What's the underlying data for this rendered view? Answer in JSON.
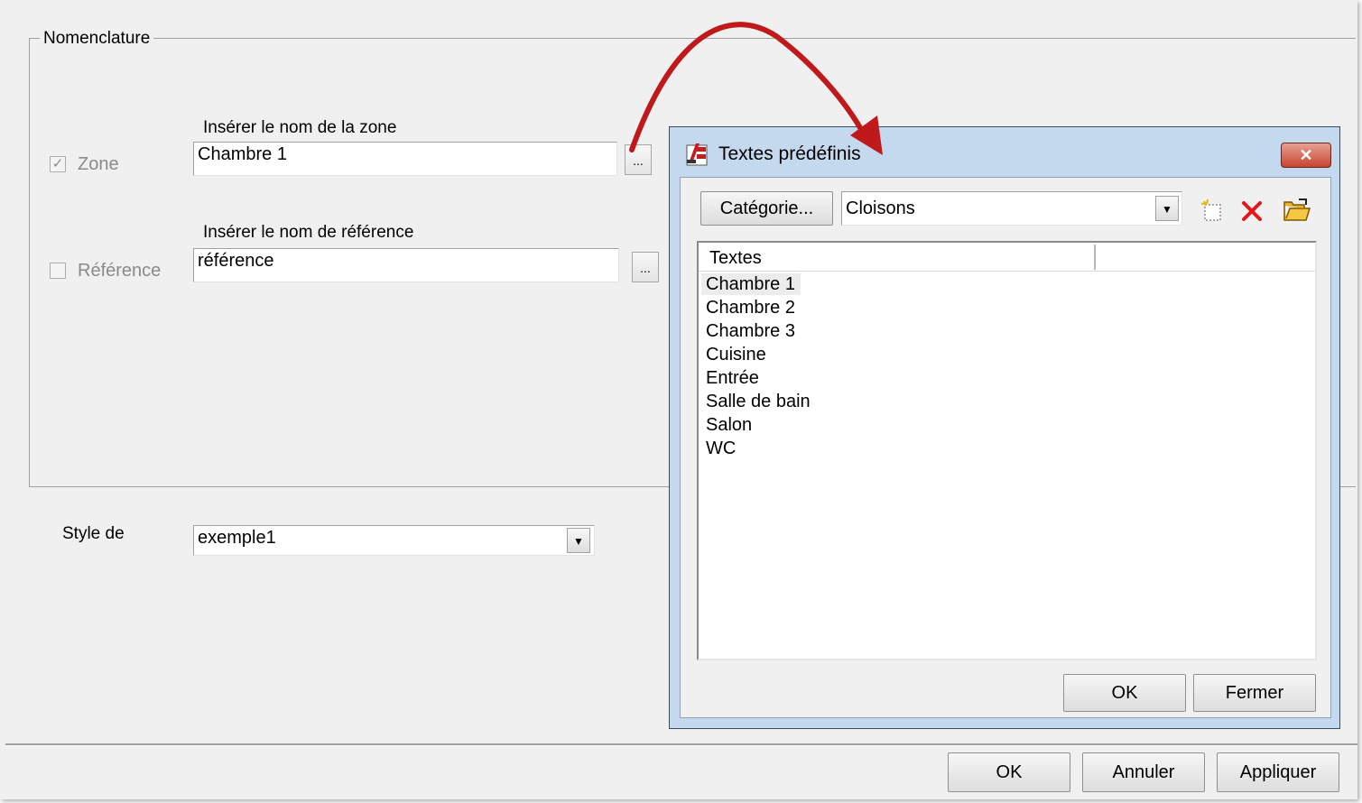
{
  "main": {
    "group_title": "Nomenclature",
    "zone": {
      "checkbox_label": "Zone",
      "checked": true,
      "field_label": "Insérer le nom de la zone",
      "value": "Chambre 1",
      "browse_label": "..."
    },
    "reference": {
      "checkbox_label": "Référence",
      "checked": false,
      "field_label": "Insérer le nom de référence",
      "value": "référence",
      "browse_label": "..."
    },
    "style": {
      "label": "Style de",
      "value": "exemple1"
    },
    "buttons": {
      "ok": "OK",
      "cancel": "Annuler",
      "apply": "Appliquer"
    }
  },
  "popup": {
    "title": "Textes prédéfinis",
    "close_label": "✕",
    "category_button": "Catégorie...",
    "category_value": "Cloisons",
    "list_header": "Textes",
    "items": [
      "Chambre 1",
      "Chambre 2",
      "Chambre 3",
      "Cuisine",
      "Entrée",
      "Salle de bain",
      "Salon",
      "WC"
    ],
    "selected_index": 0,
    "ok": "OK",
    "close": "Fermer"
  },
  "colors": {
    "arrow": "#c0191b",
    "delete_icon": "#e3161b",
    "title_close_button": "#c7452f"
  }
}
